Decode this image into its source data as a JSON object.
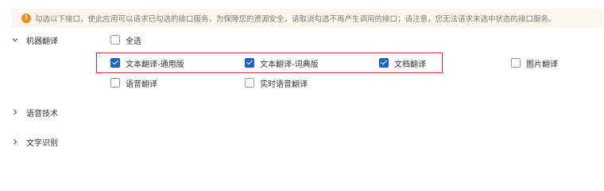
{
  "notice": {
    "icon": "warning-icon",
    "text": "勾选以下接口，使此应用可以请求已勾选的接口服务，为保障您的资源安全，请取消勾选不再产生调用的接口；请注意，您无法请求未选中状态的接口服务。"
  },
  "sections": {
    "machine_translation": {
      "label": "机器翻译",
      "select_all": "全选",
      "items": [
        {
          "label": "文本翻译-通用版",
          "checked": true
        },
        {
          "label": "文本翻译-词典版",
          "checked": true
        },
        {
          "label": "文档翻译",
          "checked": true
        },
        {
          "label": "图片翻译",
          "checked": false
        },
        {
          "label": "语音翻译",
          "checked": false
        },
        {
          "label": "实时语音翻译",
          "checked": false
        }
      ]
    },
    "speech_tech": {
      "label": "语音技术"
    },
    "ocr": {
      "label": "文字识别"
    }
  },
  "colors": {
    "accent": "#1f5fc9",
    "warning": "#ee8b1f",
    "notice_bg": "#fdf6ec",
    "highlight_border": "#e0262d"
  }
}
